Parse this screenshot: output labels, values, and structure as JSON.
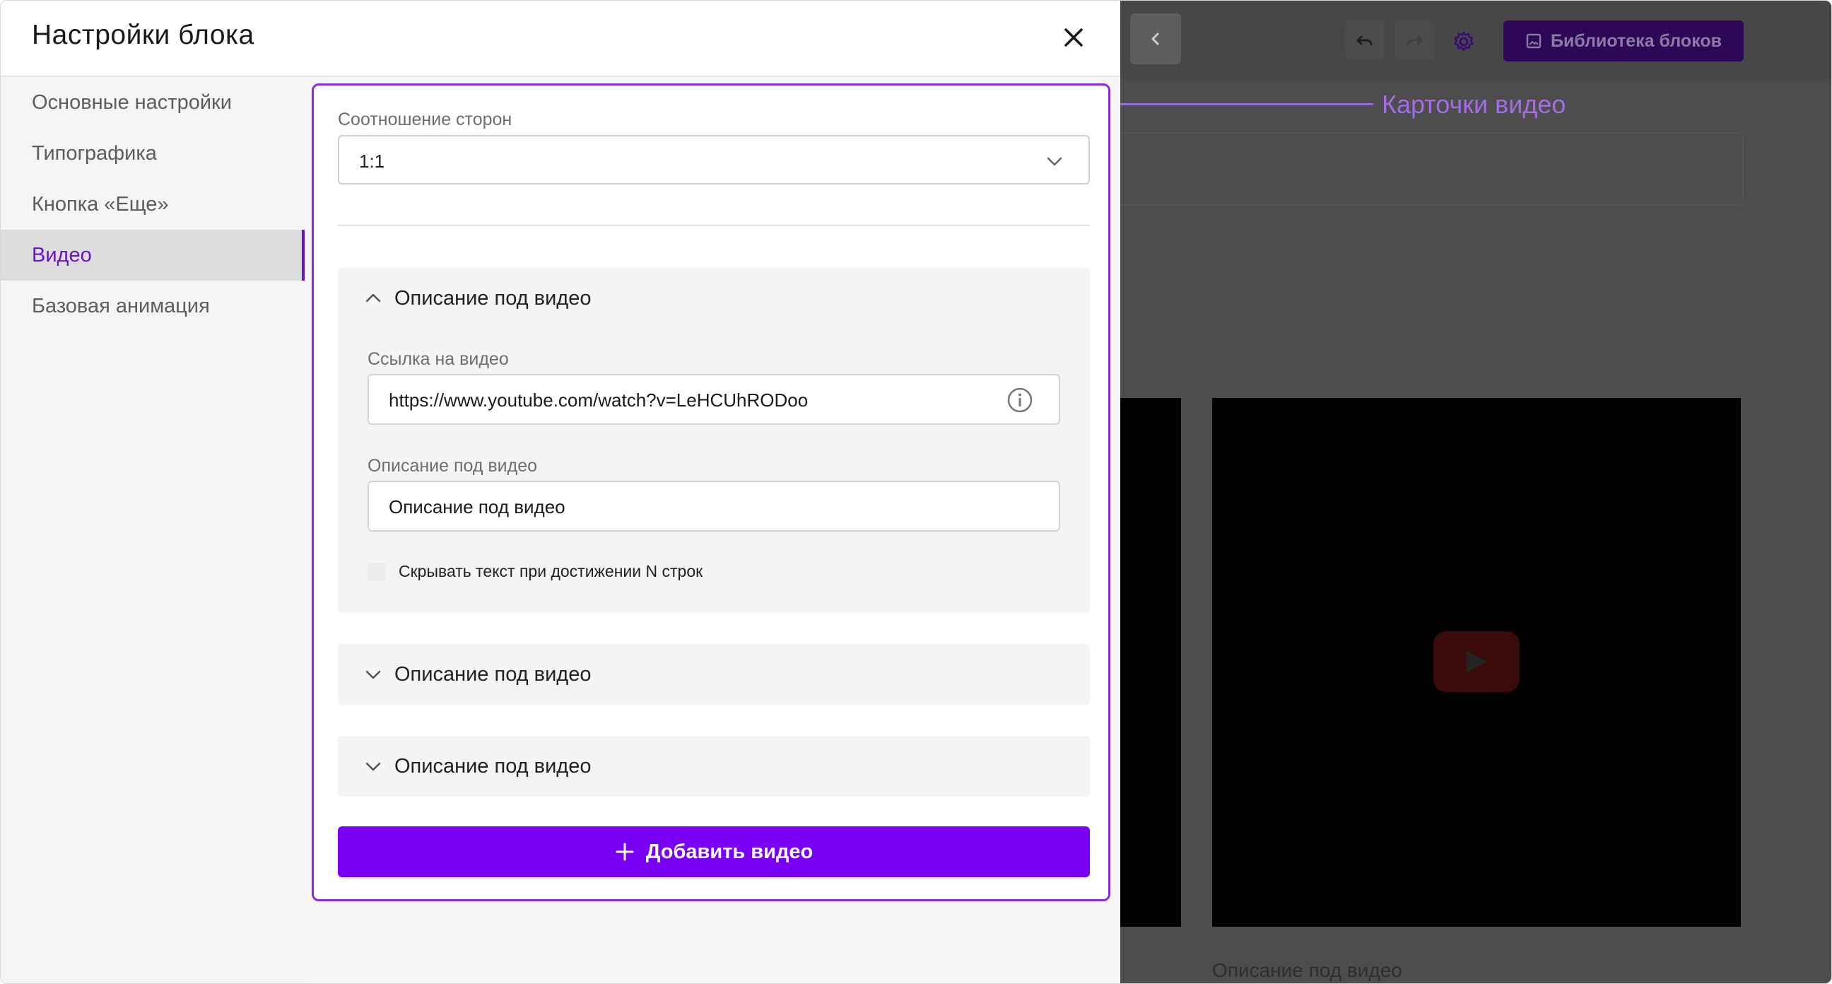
{
  "panel": {
    "title": "Настройки блока",
    "nav": [
      {
        "label": "Основные настройки",
        "active": false
      },
      {
        "label": "Типографика",
        "active": false
      },
      {
        "label": "Кнопка «Еще»",
        "active": false
      },
      {
        "label": "Видео",
        "active": true
      },
      {
        "label": "Базовая анимация",
        "active": false
      }
    ]
  },
  "video_settings": {
    "aspect_label": "Соотношение сторон",
    "aspect_value": "1:1",
    "cards": [
      {
        "title": "Описание под видео",
        "expanded": true,
        "link_label": "Ссылка на видео",
        "link_value": "https://www.youtube.com/watch?v=LeHCUhRODoo",
        "desc_label": "Описание под видео",
        "desc_value": "Описание под видео",
        "hide_text_label": "Скрывать текст при достижении N строк"
      },
      {
        "title": "Описание под видео",
        "expanded": false
      },
      {
        "title": "Описание под видео",
        "expanded": false
      }
    ],
    "add_button": "Добавить видео"
  },
  "editor": {
    "library_button": "Библиотека блоков",
    "caption": "Описание под видео"
  },
  "annotation": {
    "callout": "Карточки видео"
  },
  "colors": {
    "accent": "#7a00f5",
    "highlight_border": "#8a2be2",
    "callout": "#a26ce6"
  }
}
